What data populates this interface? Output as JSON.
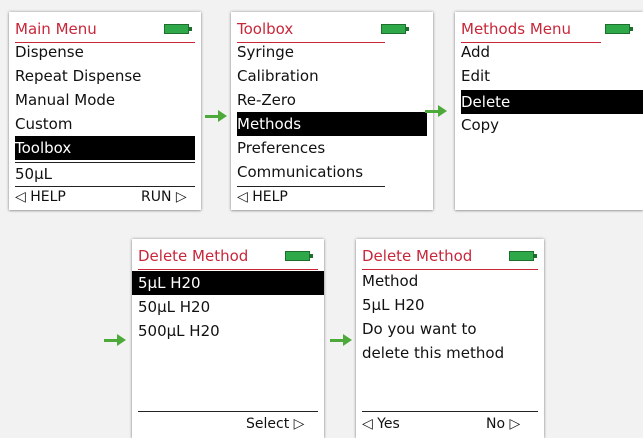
{
  "screens": {
    "main_menu": {
      "title": "Main Menu",
      "items": [
        "Dispense",
        "Repeat Dispense",
        "Manual Mode",
        "Custom",
        "Toolbox"
      ],
      "selected": "Toolbox",
      "volume": "50μL",
      "left_soft": "◁ HELP",
      "right_soft": "RUN ▷"
    },
    "toolbox": {
      "title": "Toolbox",
      "items": [
        "Syringe",
        "Calibration",
        "Re-Zero",
        "Methods",
        "Preferences",
        "Communications"
      ],
      "selected": "Methods",
      "left_soft": "◁ HELP"
    },
    "methods_menu": {
      "title": "Methods Menu",
      "items": [
        "Add",
        "Edit",
        "Delete",
        "Copy"
      ],
      "selected": "Delete"
    },
    "delete_method_list": {
      "title": "Delete Method",
      "items": [
        "5μL H20",
        "50μL H20",
        "500μL H20"
      ],
      "selected": "5μL H20",
      "right_soft": "Select ▷"
    },
    "delete_method_confirm": {
      "title": "Delete Method",
      "lines": [
        "Method",
        "5μL H20",
        "Do you want to",
        "delete this method"
      ],
      "left_soft": "◁ Yes",
      "right_soft": "No ▷"
    }
  },
  "colors": {
    "title_red": "#c8273a",
    "battery_green": "#2fa84a",
    "arrow_green": "#4daa3a",
    "selection_bg": "#000000"
  }
}
